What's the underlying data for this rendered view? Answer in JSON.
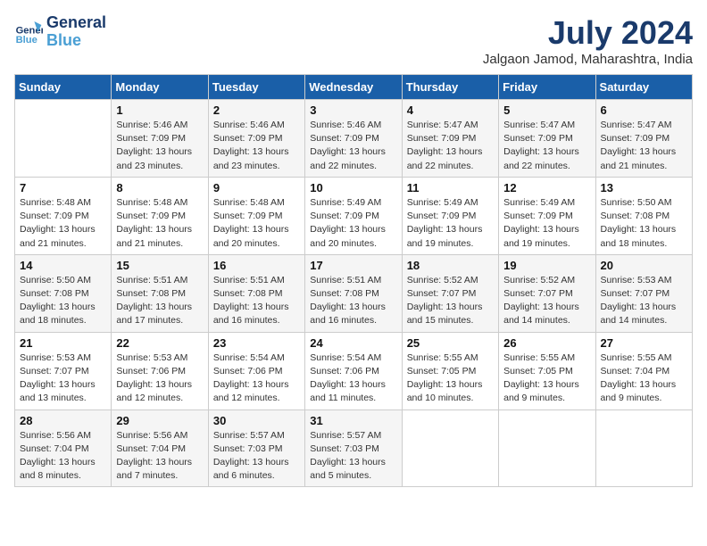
{
  "header": {
    "logo_line1": "General",
    "logo_line2": "Blue",
    "month_title": "July 2024",
    "location": "Jalgaon Jamod, Maharashtra, India"
  },
  "weekdays": [
    "Sunday",
    "Monday",
    "Tuesday",
    "Wednesday",
    "Thursday",
    "Friday",
    "Saturday"
  ],
  "weeks": [
    [
      {
        "day": "",
        "info": ""
      },
      {
        "day": "1",
        "info": "Sunrise: 5:46 AM\nSunset: 7:09 PM\nDaylight: 13 hours\nand 23 minutes."
      },
      {
        "day": "2",
        "info": "Sunrise: 5:46 AM\nSunset: 7:09 PM\nDaylight: 13 hours\nand 23 minutes."
      },
      {
        "day": "3",
        "info": "Sunrise: 5:46 AM\nSunset: 7:09 PM\nDaylight: 13 hours\nand 22 minutes."
      },
      {
        "day": "4",
        "info": "Sunrise: 5:47 AM\nSunset: 7:09 PM\nDaylight: 13 hours\nand 22 minutes."
      },
      {
        "day": "5",
        "info": "Sunrise: 5:47 AM\nSunset: 7:09 PM\nDaylight: 13 hours\nand 22 minutes."
      },
      {
        "day": "6",
        "info": "Sunrise: 5:47 AM\nSunset: 7:09 PM\nDaylight: 13 hours\nand 21 minutes."
      }
    ],
    [
      {
        "day": "7",
        "info": "Sunrise: 5:48 AM\nSunset: 7:09 PM\nDaylight: 13 hours\nand 21 minutes."
      },
      {
        "day": "8",
        "info": "Sunrise: 5:48 AM\nSunset: 7:09 PM\nDaylight: 13 hours\nand 21 minutes."
      },
      {
        "day": "9",
        "info": "Sunrise: 5:48 AM\nSunset: 7:09 PM\nDaylight: 13 hours\nand 20 minutes."
      },
      {
        "day": "10",
        "info": "Sunrise: 5:49 AM\nSunset: 7:09 PM\nDaylight: 13 hours\nand 20 minutes."
      },
      {
        "day": "11",
        "info": "Sunrise: 5:49 AM\nSunset: 7:09 PM\nDaylight: 13 hours\nand 19 minutes."
      },
      {
        "day": "12",
        "info": "Sunrise: 5:49 AM\nSunset: 7:09 PM\nDaylight: 13 hours\nand 19 minutes."
      },
      {
        "day": "13",
        "info": "Sunrise: 5:50 AM\nSunset: 7:08 PM\nDaylight: 13 hours\nand 18 minutes."
      }
    ],
    [
      {
        "day": "14",
        "info": "Sunrise: 5:50 AM\nSunset: 7:08 PM\nDaylight: 13 hours\nand 18 minutes."
      },
      {
        "day": "15",
        "info": "Sunrise: 5:51 AM\nSunset: 7:08 PM\nDaylight: 13 hours\nand 17 minutes."
      },
      {
        "day": "16",
        "info": "Sunrise: 5:51 AM\nSunset: 7:08 PM\nDaylight: 13 hours\nand 16 minutes."
      },
      {
        "day": "17",
        "info": "Sunrise: 5:51 AM\nSunset: 7:08 PM\nDaylight: 13 hours\nand 16 minutes."
      },
      {
        "day": "18",
        "info": "Sunrise: 5:52 AM\nSunset: 7:07 PM\nDaylight: 13 hours\nand 15 minutes."
      },
      {
        "day": "19",
        "info": "Sunrise: 5:52 AM\nSunset: 7:07 PM\nDaylight: 13 hours\nand 14 minutes."
      },
      {
        "day": "20",
        "info": "Sunrise: 5:53 AM\nSunset: 7:07 PM\nDaylight: 13 hours\nand 14 minutes."
      }
    ],
    [
      {
        "day": "21",
        "info": "Sunrise: 5:53 AM\nSunset: 7:07 PM\nDaylight: 13 hours\nand 13 minutes."
      },
      {
        "day": "22",
        "info": "Sunrise: 5:53 AM\nSunset: 7:06 PM\nDaylight: 13 hours\nand 12 minutes."
      },
      {
        "day": "23",
        "info": "Sunrise: 5:54 AM\nSunset: 7:06 PM\nDaylight: 13 hours\nand 12 minutes."
      },
      {
        "day": "24",
        "info": "Sunrise: 5:54 AM\nSunset: 7:06 PM\nDaylight: 13 hours\nand 11 minutes."
      },
      {
        "day": "25",
        "info": "Sunrise: 5:55 AM\nSunset: 7:05 PM\nDaylight: 13 hours\nand 10 minutes."
      },
      {
        "day": "26",
        "info": "Sunrise: 5:55 AM\nSunset: 7:05 PM\nDaylight: 13 hours\nand 9 minutes."
      },
      {
        "day": "27",
        "info": "Sunrise: 5:55 AM\nSunset: 7:04 PM\nDaylight: 13 hours\nand 9 minutes."
      }
    ],
    [
      {
        "day": "28",
        "info": "Sunrise: 5:56 AM\nSunset: 7:04 PM\nDaylight: 13 hours\nand 8 minutes."
      },
      {
        "day": "29",
        "info": "Sunrise: 5:56 AM\nSunset: 7:04 PM\nDaylight: 13 hours\nand 7 minutes."
      },
      {
        "day": "30",
        "info": "Sunrise: 5:57 AM\nSunset: 7:03 PM\nDaylight: 13 hours\nand 6 minutes."
      },
      {
        "day": "31",
        "info": "Sunrise: 5:57 AM\nSunset: 7:03 PM\nDaylight: 13 hours\nand 5 minutes."
      },
      {
        "day": "",
        "info": ""
      },
      {
        "day": "",
        "info": ""
      },
      {
        "day": "",
        "info": ""
      }
    ]
  ]
}
